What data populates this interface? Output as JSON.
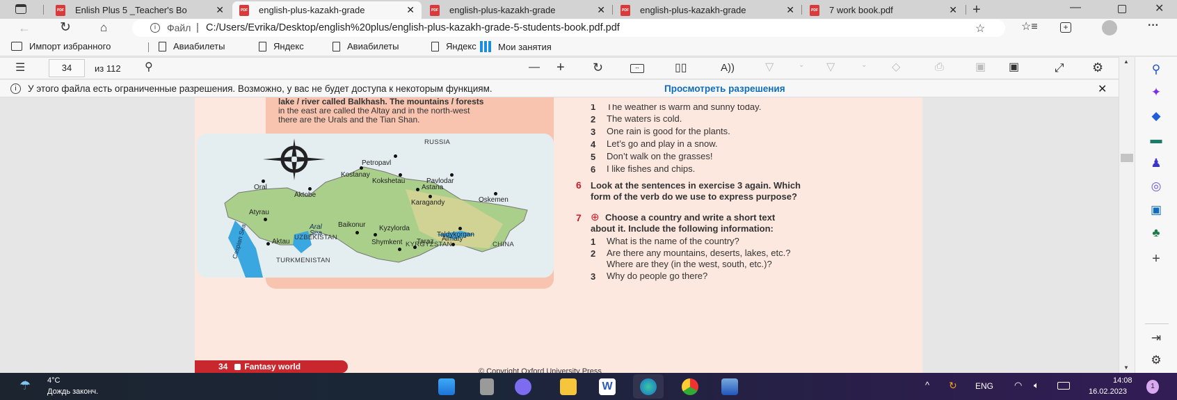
{
  "tabs": [
    {
      "label": "Enlish Plus 5 _Teacher's Bo",
      "active": false
    },
    {
      "label": "english-plus-kazakh-grade",
      "active": true
    },
    {
      "label": "english-plus-kazakh-grade",
      "active": false
    },
    {
      "label": "english-plus-kazakh-grade",
      "active": false
    },
    {
      "label": "7 work book.pdf",
      "active": false
    }
  ],
  "pdf_badge": "PDF",
  "address": {
    "scheme_label": "Файл",
    "url": "C:/Users/Evrika/Desktop/english%20plus/english-plus-kazakh-grade-5-students-book.pdf.pdf"
  },
  "favorites": [
    {
      "label": "Импорт избранного"
    },
    {
      "label": "Авиабилеты"
    },
    {
      "label": "Яндекс"
    },
    {
      "label": "Авиабилеты"
    },
    {
      "label": "Яндекс"
    },
    {
      "label": "Мои занятия"
    }
  ],
  "pdf_toolbar": {
    "page": "34",
    "total": "из 112"
  },
  "notice": {
    "text": "У этого файла есть ограниченные разрешения. Возможно, у вас не будет доступа к некоторым функциям.",
    "link": "Просмотреть разрешения"
  },
  "page": {
    "left_text": [
      "lake / river called Balkhash. The mountains / forests",
      "in the east are called the Altay and in the north-west",
      "there are the Urals and the Tian Shan."
    ],
    "map": {
      "cities": [
        "Petropavl",
        "Kostanay",
        "Kokshetau",
        "Pavlodar",
        "Oral",
        "Aktobe",
        "Astana",
        "Karagandy",
        "Oskemen",
        "Atyrau",
        "Baikonur",
        "Kyzylorda",
        "Taldykorgan",
        "Aktau",
        "Shymkent",
        "Taraz",
        "Almaty"
      ],
      "countries": [
        "RUSSIA",
        "UZBEKISTAN",
        "KYRGYZSTAN",
        "CHINA",
        "TURKMENISTAN"
      ],
      "water": [
        "Aral Sea",
        "Caspian Sea"
      ]
    },
    "list_top": [
      {
        "n": "1",
        "t": "The weather is warm and sunny today."
      },
      {
        "n": "2",
        "t": "The waters is cold."
      },
      {
        "n": "3",
        "t": "One rain is good for the plants."
      },
      {
        "n": "4",
        "t": "Let’s go and play in a snow."
      },
      {
        "n": "5",
        "t": "Don’t walk on the grasses!"
      },
      {
        "n": "6",
        "t": "I like fishes and chips."
      }
    ],
    "ex6": {
      "n": "6",
      "lines": [
        "Look at the sentences in exercise 3 again. Which",
        "form of the verb do we use to express purpose?"
      ]
    },
    "ex7": {
      "n": "7",
      "lines": [
        "Choose a country and write a short text",
        "about it. Include the following information:"
      ]
    },
    "list_bottom": [
      {
        "n": "1",
        "t": "What is the name of the country?"
      },
      {
        "n": "2",
        "t": "Are there any mountains, deserts, lakes, etc.?"
      },
      {
        "n": "",
        "t": "Where are they (in the west, south, etc.)?"
      },
      {
        "n": "3",
        "t": "Why do people go there?"
      }
    ],
    "footer": {
      "page": "34",
      "section": "Fantasy world"
    },
    "copyright": "© Copyright Oxford University Press"
  },
  "taskbar": {
    "temp": "4°C",
    "weather": "Дождь законч.",
    "lang": "ENG",
    "time": "14:08",
    "date": "16.02.2023",
    "notifications": "1"
  }
}
